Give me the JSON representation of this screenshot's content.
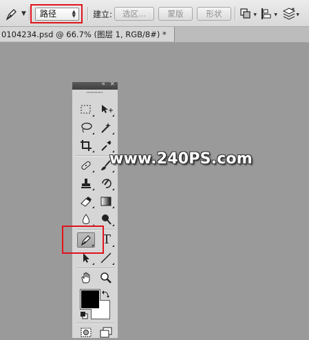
{
  "options_bar": {
    "tool_preset_icon": "pen-icon",
    "mode_value": "路径",
    "make_label": "建立:",
    "selection_button": "选区...",
    "mask_button": "蒙版",
    "shape_button": "形状",
    "path_operations_icon": "path-operations-icon",
    "path_alignment_icon": "path-alignment-icon",
    "path_arrangement_icon": "path-arrangement-icon"
  },
  "document_tab": {
    "title": "0104234.psd @ 66.7% (图层 1, RGB/8#) *"
  },
  "tools_panel": {
    "collapse_glyph": "«",
    "close_glyph": "×",
    "tools": [
      "rectangular-marquee-icon",
      "move-icon",
      "lasso-icon",
      "magic-wand-icon",
      "crop-icon",
      "eyedropper-icon",
      "healing-brush-icon",
      "brush-icon",
      "clone-stamp-icon",
      "history-brush-icon",
      "eraser-icon",
      "gradient-icon",
      "blur-icon",
      "dodge-icon",
      "pen-icon",
      "type-icon",
      "path-selection-icon",
      "line-icon",
      "hand-icon",
      "zoom-icon"
    ],
    "type_glyph": "T",
    "foreground_color": "#000000",
    "background_color": "#ffffff"
  },
  "watermark": "www.240PS.com",
  "colors": {
    "highlight": "#e0121a",
    "workspace": "#9a9a9a"
  }
}
